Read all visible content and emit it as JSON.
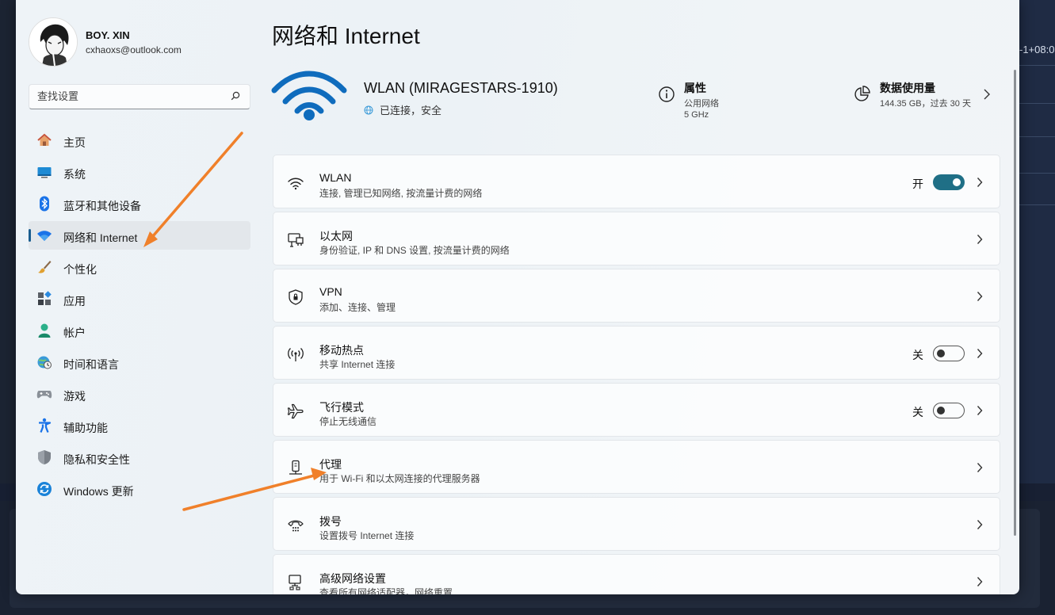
{
  "background": {
    "timezone_fragment": "-1+08:0"
  },
  "profile": {
    "name": "BOY. XIN",
    "email": "cxhaoxs@outlook.com"
  },
  "search": {
    "placeholder": "查找设置"
  },
  "sidebar": {
    "items": [
      {
        "label": "主页",
        "icon": "home-icon"
      },
      {
        "label": "系统",
        "icon": "system-icon"
      },
      {
        "label": "蓝牙和其他设备",
        "icon": "bluetooth-icon"
      },
      {
        "label": "网络和 Internet",
        "icon": "wifi-icon",
        "active": true
      },
      {
        "label": "个性化",
        "icon": "brush-icon"
      },
      {
        "label": "应用",
        "icon": "apps-icon"
      },
      {
        "label": "帐户",
        "icon": "account-icon"
      },
      {
        "label": "时间和语言",
        "icon": "clock-globe-icon"
      },
      {
        "label": "游戏",
        "icon": "gamepad-icon"
      },
      {
        "label": "辅助功能",
        "icon": "accessibility-icon"
      },
      {
        "label": "隐私和安全性",
        "icon": "shield-icon"
      },
      {
        "label": "Windows 更新",
        "icon": "update-icon"
      }
    ]
  },
  "page": {
    "title": "网络和 Internet"
  },
  "network": {
    "name": "WLAN (MIRAGESTARS-1910)",
    "status": "已连接，安全"
  },
  "properties": {
    "title": "属性",
    "line1": "公用网络",
    "line2": "5 GHz"
  },
  "usage": {
    "title": "数据使用量",
    "detail": "144.35 GB，过去 30 天"
  },
  "cards": [
    {
      "title": "WLAN",
      "subtitle": "连接, 管理已知网络, 按流量计费的网络",
      "icon": "wifi-icon",
      "toggle_label": "开",
      "toggle_on": true
    },
    {
      "title": "以太网",
      "subtitle": "身份验证, IP 和 DNS 设置, 按流量计费的网络",
      "icon": "ethernet-icon"
    },
    {
      "title": "VPN",
      "subtitle": "添加、连接、管理",
      "icon": "vpn-shield-icon"
    },
    {
      "title": "移动热点",
      "subtitle": "共享 Internet 连接",
      "icon": "hotspot-icon",
      "toggle_label": "关",
      "toggle_on": false
    },
    {
      "title": "飞行模式",
      "subtitle": "停止无线通信",
      "icon": "airplane-icon",
      "toggle_label": "关",
      "toggle_on": false
    },
    {
      "title": "代理",
      "subtitle": "用于 Wi-Fi 和以太网连接的代理服务器",
      "icon": "proxy-icon"
    },
    {
      "title": "拨号",
      "subtitle": "设置拨号 Internet 连接",
      "icon": "dialup-icon"
    },
    {
      "title": "高级网络设置",
      "subtitle": "查看所有网络适配器，网络重置",
      "icon": "advanced-network-icon"
    }
  ],
  "colors": {
    "accent": "#1f6f86",
    "wifi_blue": "#0f6cbd",
    "annotation_arrow": "#f0802a"
  }
}
